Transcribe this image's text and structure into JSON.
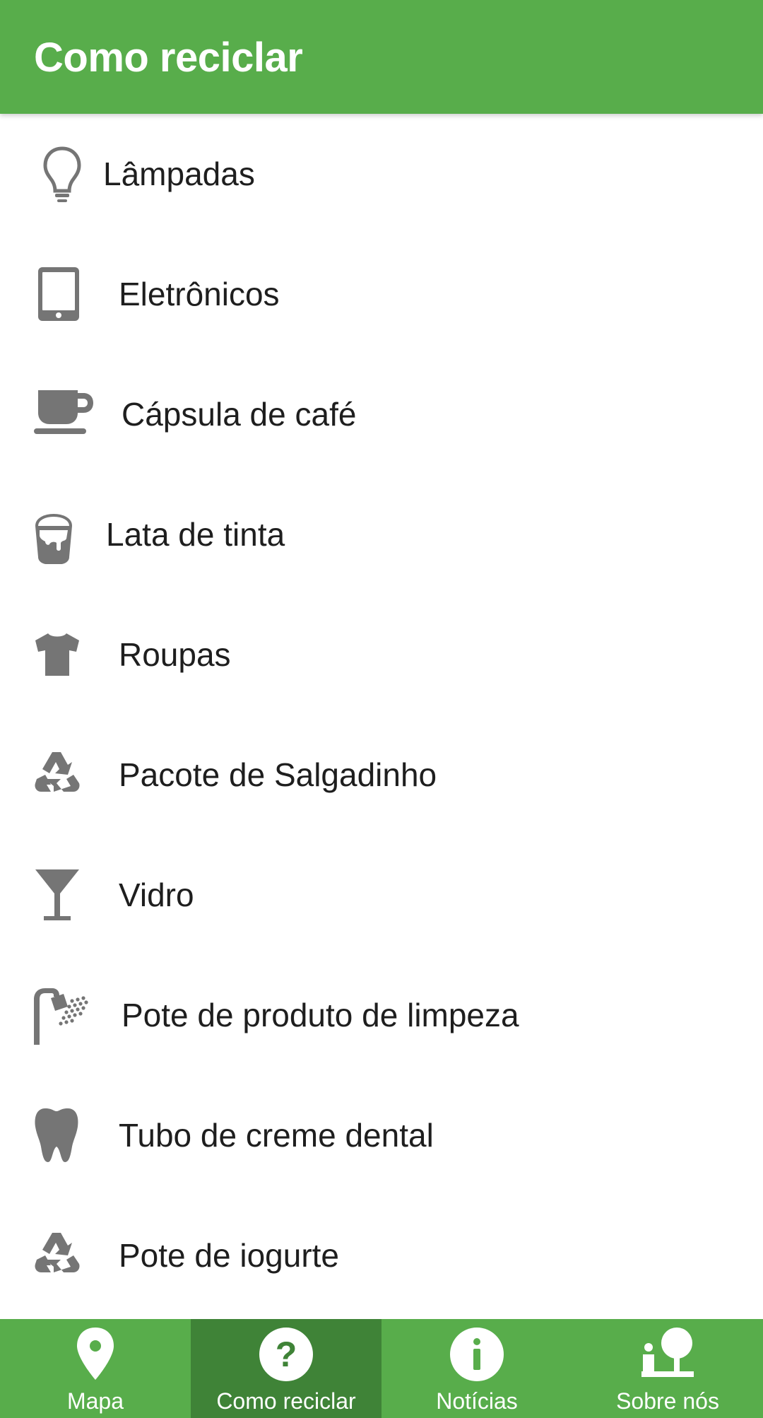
{
  "app_bar": {
    "title": "Como reciclar"
  },
  "items": [
    {
      "label": "Lâmpadas",
      "icon": "lightbulb-icon"
    },
    {
      "label": "Eletrônicos",
      "icon": "tablet-icon"
    },
    {
      "label": "Cápsula de café",
      "icon": "coffee-cup-icon"
    },
    {
      "label": "Lata de tinta",
      "icon": "paint-bucket-icon"
    },
    {
      "label": "Roupas",
      "icon": "tshirt-icon"
    },
    {
      "label": "Pacote de Salgadinho",
      "icon": "recycle-icon"
    },
    {
      "label": "Vidro",
      "icon": "cocktail-glass-icon"
    },
    {
      "label": "Pote de produto de limpeza",
      "icon": "shower-icon"
    },
    {
      "label": "Tubo de creme dental",
      "icon": "tooth-icon"
    },
    {
      "label": "Pote de iogurte",
      "icon": "recycle-icon"
    }
  ],
  "bottom_nav": [
    {
      "label": "Mapa",
      "icon": "map-pin-icon",
      "active": false
    },
    {
      "label": "Como reciclar",
      "icon": "question-icon",
      "active": true
    },
    {
      "label": "Notícias",
      "icon": "info-icon",
      "active": false
    },
    {
      "label": "Sobre nós",
      "icon": "people-icon",
      "active": false
    }
  ],
  "colors": {
    "primary": "#58ad4b",
    "active_tab": "#3f8337",
    "icon_gray": "#757575",
    "text": "#1e1e1e"
  }
}
